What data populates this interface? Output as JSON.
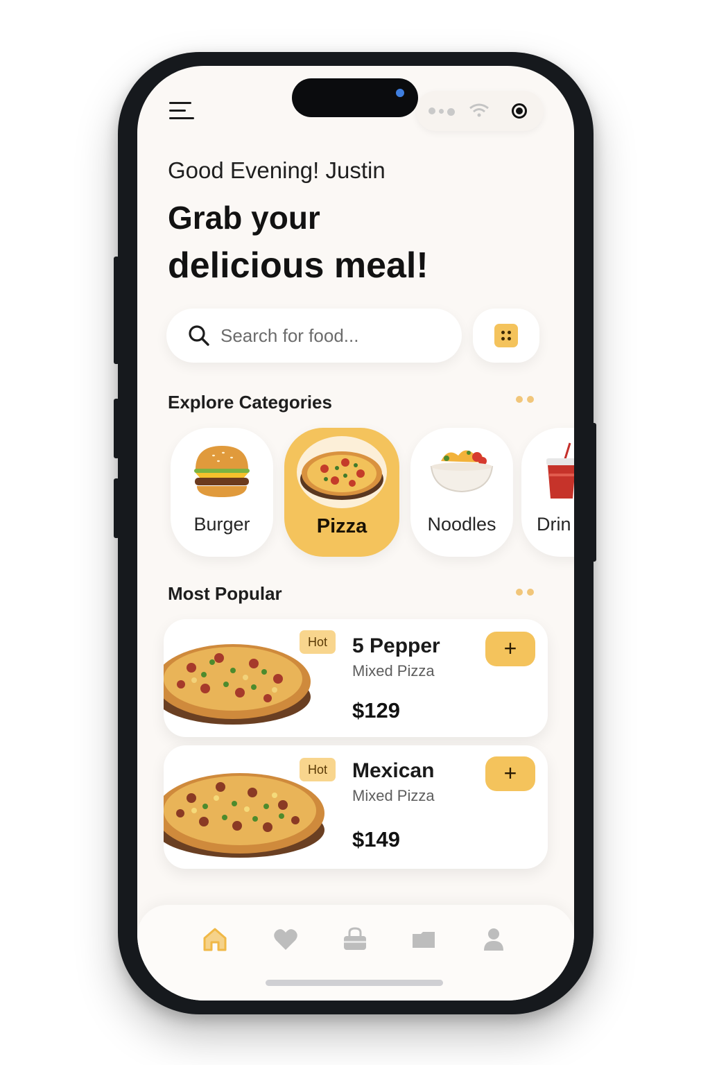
{
  "app": {
    "greeting": "Good Evening! Justin",
    "headline_line1": "Grab your",
    "headline_line2": "delicious meal!"
  },
  "search": {
    "placeholder": "Search for food..."
  },
  "sections": {
    "categories_title": "Explore Categories",
    "popular_title": "Most Popular"
  },
  "categories": [
    {
      "label": "Burger",
      "icon": "burger-icon"
    },
    {
      "label": "Pizza",
      "icon": "pizza-icon",
      "selected": true
    },
    {
      "label": "Noodles",
      "icon": "noodles-icon"
    },
    {
      "label": "Drin",
      "icon": "drink-icon"
    }
  ],
  "popular": [
    {
      "badge": "Hot",
      "name": "5 Pepper",
      "desc": "Mixed Pizza",
      "price": "$129",
      "add": "+"
    },
    {
      "badge": "Hot",
      "name": "Mexican",
      "desc": "Mixed Pizza",
      "price": "$149",
      "add": "+"
    }
  ],
  "nav": [
    "home-icon",
    "heart-icon",
    "bag-icon",
    "wallet-icon",
    "profile-icon"
  ],
  "colors": {
    "accent": "#f4c35c",
    "background": "#fbf8f5",
    "frame": "#16191d",
    "active_nav": "#f0b847",
    "inactive_nav": "#bdbdbd"
  }
}
